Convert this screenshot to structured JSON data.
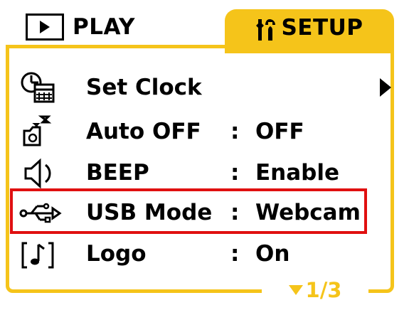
{
  "colors": {
    "accent": "#f5c41a",
    "highlight": "#e01010"
  },
  "tabs": {
    "play": {
      "label": "PLAY",
      "icon": "play-icon"
    },
    "setup": {
      "label": "SETUP",
      "icon": "tools-icon"
    }
  },
  "menu": {
    "items": [
      {
        "icon": "clock-calendar-icon",
        "label": "Set Clock",
        "value": "",
        "has_submenu": true
      },
      {
        "icon": "camera-sleep-icon",
        "label": "Auto OFF",
        "value": "OFF"
      },
      {
        "icon": "speaker-icon",
        "label": "BEEP",
        "value": "Enable"
      },
      {
        "icon": "usb-icon",
        "label": "USB Mode",
        "value": "Webcam",
        "highlighted": true
      },
      {
        "icon": "logo-music-icon",
        "label": "Logo",
        "value": "On"
      }
    ],
    "colon": ":"
  },
  "pager": {
    "text": "1/3",
    "icon": "triangle-down-icon"
  }
}
